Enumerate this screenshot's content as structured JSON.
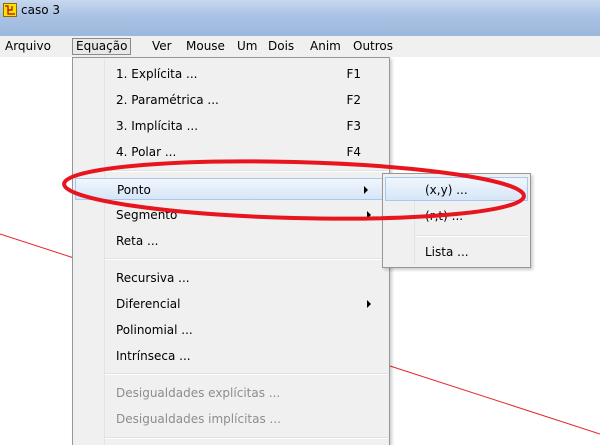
{
  "window": {
    "title": "caso 3"
  },
  "menubar": {
    "items": [
      "Arquivo",
      "Equação",
      "Ver",
      "Mouse",
      "Um",
      "Dois",
      "Anim",
      "Outros"
    ]
  },
  "equation_menu": {
    "items": [
      {
        "label": "1. Explícita ...",
        "shortcut": "F1"
      },
      {
        "label": "2. Paramétrica ...",
        "shortcut": "F2"
      },
      {
        "label": "3. Implícita ...",
        "shortcut": "F3"
      },
      {
        "label": "4. Polar ...",
        "shortcut": "F4"
      },
      {
        "label": "Ponto",
        "has_submenu": true,
        "highlighted": true
      },
      {
        "label": "Segmento",
        "has_submenu": true
      },
      {
        "label": "Reta ..."
      },
      {
        "label": "Recursiva ..."
      },
      {
        "label": "Diferencial",
        "has_submenu": true
      },
      {
        "label": "Polinomial ..."
      },
      {
        "label": "Intrínseca ..."
      },
      {
        "label": "Desigualdades explícitas ...",
        "disabled": true
      },
      {
        "label": "Desigualdades implícitas ...",
        "disabled": true
      }
    ]
  },
  "point_submenu": {
    "items": [
      {
        "label": "(x,y) ...",
        "highlighted": true
      },
      {
        "label": "(r,t) ..."
      },
      {
        "label": "Lista ..."
      }
    ]
  },
  "colors": {
    "annotation_ellipse": "#e8141e",
    "plot_line": "#e4262c",
    "highlight": "#d6e6f8",
    "menu_background": "#f0f0f0"
  }
}
